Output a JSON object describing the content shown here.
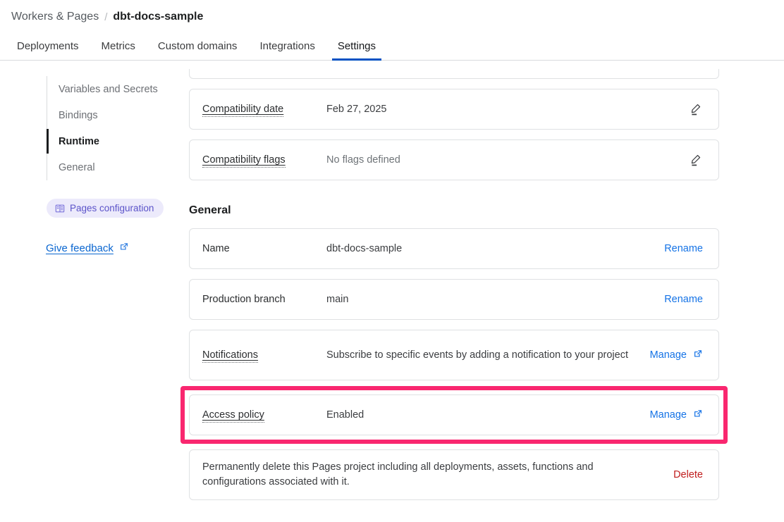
{
  "breadcrumb": {
    "root": "Workers & Pages",
    "separator": "/",
    "current": "dbt-docs-sample"
  },
  "tabs": [
    {
      "label": "Deployments",
      "active": false
    },
    {
      "label": "Metrics",
      "active": false
    },
    {
      "label": "Custom domains",
      "active": false
    },
    {
      "label": "Integrations",
      "active": false
    },
    {
      "label": "Settings",
      "active": true
    }
  ],
  "sidebar": {
    "items": [
      {
        "label": "Variables and Secrets",
        "active": false
      },
      {
        "label": "Bindings",
        "active": false
      },
      {
        "label": "Runtime",
        "active": true
      },
      {
        "label": "General",
        "active": false
      }
    ],
    "pill_label": "Pages configuration",
    "pill_icon": "book-icon",
    "feedback_label": "Give feedback",
    "feedback_icon": "external-link-icon"
  },
  "runtime_section": {
    "compatibility_date": {
      "label": "Compatibility date",
      "value": "Feb 27, 2025",
      "action_icon": "pencil-icon"
    },
    "compatibility_flags": {
      "label": "Compatibility flags",
      "value": "No flags defined",
      "action_icon": "pencil-icon"
    }
  },
  "general_section": {
    "title": "General",
    "name": {
      "label": "Name",
      "value": "dbt-docs-sample",
      "action": "Rename"
    },
    "production_branch": {
      "label": "Production branch",
      "value": "main",
      "action": "Rename"
    },
    "notifications": {
      "label": "Notifications",
      "value": "Subscribe to specific events by adding a notification to your project",
      "action": "Manage",
      "action_icon": "external-link-icon"
    },
    "access_policy": {
      "label": "Access policy",
      "value": "Enabled",
      "action": "Manage",
      "action_icon": "external-link-icon"
    },
    "delete": {
      "value": "Permanently delete this Pages project including all deployments, assets, functions and configurations associated with it.",
      "action": "Delete"
    }
  },
  "colors": {
    "accent_tab": "#0051c3",
    "link": "#1573e6",
    "danger": "#c01d1d",
    "pill_bg": "#eceafb",
    "pill_text": "#5b53c9",
    "highlight": "#f9276f"
  }
}
